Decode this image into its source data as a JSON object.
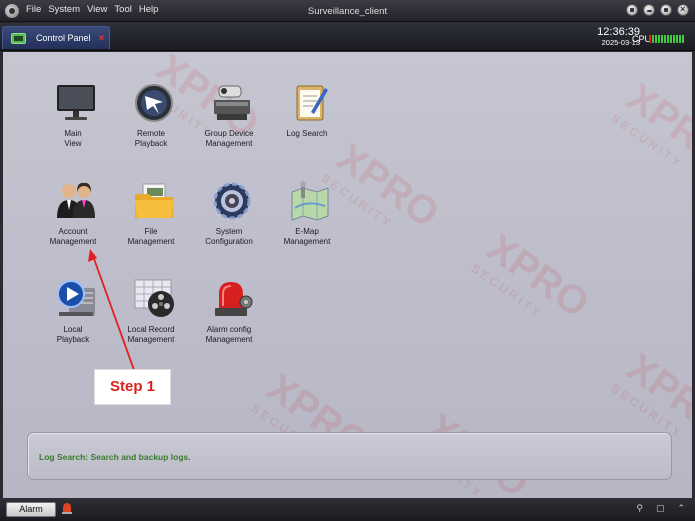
{
  "window": {
    "title": "Surveillance_client"
  },
  "menu": [
    "File",
    "System",
    "View",
    "Tool",
    "Help"
  ],
  "tab": {
    "label": "Control Panel",
    "close": "×"
  },
  "status": {
    "time": "12:36:39",
    "date": "2025-03-13",
    "cpu_label": "CPU"
  },
  "tiles": [
    {
      "id": "main-view",
      "label": "Main\nView",
      "icon": "monitor-icon"
    },
    {
      "id": "remote-playback",
      "label": "Remote\nPlayback",
      "icon": "remote-playback-icon"
    },
    {
      "id": "group-device-management",
      "label": "Group Device\nManagement",
      "icon": "device-management-icon"
    },
    {
      "id": "log-search",
      "label": "Log Search",
      "icon": "log-search-icon"
    },
    {
      "id": "account-management",
      "label": "Account\nManagement",
      "icon": "users-icon"
    },
    {
      "id": "file-management",
      "label": "File\nManagement",
      "icon": "folder-icon"
    },
    {
      "id": "system-configuration",
      "label": "System\nConfiguration",
      "icon": "gear-icon"
    },
    {
      "id": "e-map-management",
      "label": "E-Map\nManagement",
      "icon": "map-icon"
    },
    {
      "id": "local-playback",
      "label": "Local\nPlayback",
      "icon": "local-playback-icon"
    },
    {
      "id": "local-record-management",
      "label": "Local Record\nManagement",
      "icon": "film-reel-icon"
    },
    {
      "id": "alarm-config-management",
      "label": "Alarm config\nManagement",
      "icon": "alarm-light-icon"
    }
  ],
  "info": {
    "text": "Log Search: Search and backup logs."
  },
  "annotation": {
    "label": "Step 1"
  },
  "watermark": {
    "brand": "XPRO",
    "sub": "SECURITY"
  },
  "statusbar": {
    "alarm_label": "Alarm",
    "pin": "⚲",
    "window": "▢",
    "collapse": "⌃"
  },
  "colors": {
    "accent_tab": "#2e3a66",
    "info_text": "#3a7a2e",
    "step_red": "#d8231d",
    "cpu_green": "#3ecc3e"
  }
}
